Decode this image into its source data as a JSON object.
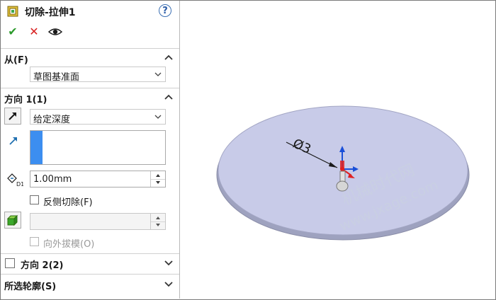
{
  "feature": {
    "title": "切除-拉伸1",
    "icon": "cut-extrude-icon",
    "help_label": "?"
  },
  "actions": {
    "ok": "✔",
    "cancel": "✕",
    "preview": "eye-icon"
  },
  "sections": {
    "from": {
      "label": "从(F)",
      "dropdown_value": "草图基准面"
    },
    "direction1": {
      "label": "方向 1(1)",
      "end_condition": "给定深度",
      "depth": "1.00mm",
      "flip_side_label": "反侧切除(F)",
      "draft_outward_label": "向外拔模(O)"
    },
    "direction2": {
      "label": "方向 2(2)"
    },
    "selected_contours": {
      "label": "所选轮廓(S)"
    }
  },
  "viewport": {
    "dimension_label": "Ø3",
    "watermark_line1": "机械时代网",
    "watermark_line2": "www.jxage.com",
    "colors": {
      "disk_fill": "#c8cbe8",
      "disk_edge": "#8a8da8",
      "axis_x": "#e02020",
      "axis_y": "#1a4fd8",
      "axis_z": "#2a9a2a"
    }
  }
}
